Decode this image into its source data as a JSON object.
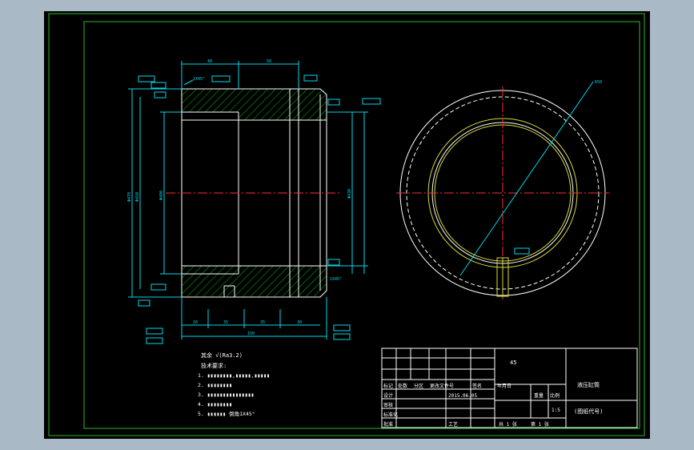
{
  "colors": {
    "viewport_bg": "#000000",
    "frame": "#2db82d",
    "outline": "#ffffff",
    "geometry": "#d8d83a",
    "hatch": "#00c000",
    "dimension": "#00d8e8",
    "center_line": "#ff2c2c",
    "text": "#ffffff",
    "note_text": "#ffffff"
  },
  "dimensions": {
    "top_left_40": "40",
    "top_right_50": "50",
    "bottom_total_150": "150",
    "bottom_segments": [
      "20",
      "35",
      "35",
      "30"
    ],
    "radius_r50": "R50",
    "chamfer_2x45": "2X45°",
    "chamfer_1x45": "1X45°",
    "dia_left_1": "Φ470",
    "dia_left_2": "Φ450",
    "dia_left_3": "Φ400",
    "dia_right": "Φ430"
  },
  "notes": {
    "roughness_line": "其余 √(Ra3.2)",
    "title": "技术要求:",
    "items": [
      "1. ▮▮▮▮▮▮▮▮,▮▮▮▮▮,▮▮▮▮▮",
      "2. ▮▮▮▮▮▮▮▮",
      "3. ▮▮▮▮▮▮▮▮▮▮▮▮▮▮▮",
      "4. ▮▮▮▮▮▮▮▮",
      "5. ▮▮▮▮▮▮ 倒角1X45°"
    ]
  },
  "title_block": {
    "material_code": "45",
    "part_name": "液压缸筒",
    "drawing_no": "(图纸代号)",
    "row_labels": {
      "mark": "标记",
      "count": "处数",
      "zone": "分区",
      "change_doc": "更改文件号",
      "signature": "签名",
      "date": "年月日",
      "design": "设计",
      "check": "审核",
      "standardize": "标准化",
      "process": "工艺",
      "approve": "批准"
    },
    "design_date": "2015.06.05",
    "weight_label": "重量",
    "scale_label": "比例",
    "scale_value": "1:5",
    "sheet_total": "共 1 张",
    "sheet_no": "第 1 张"
  }
}
